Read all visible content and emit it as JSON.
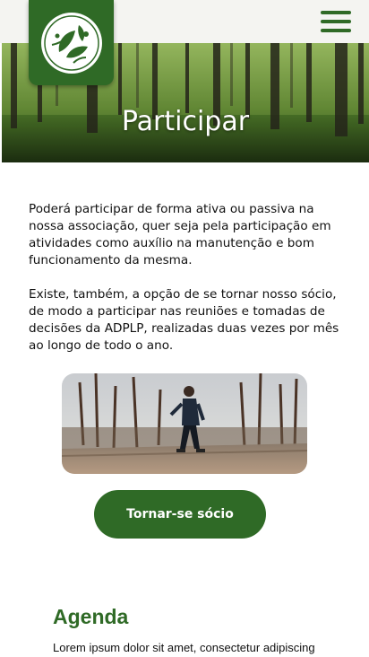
{
  "header": {
    "logo_icon": "leaf-circle-logo-icon",
    "menu_icon": "hamburger-menu-icon"
  },
  "hero": {
    "title": "Participar"
  },
  "main": {
    "paragraph_1": "Poderá participar de forma ativa ou passiva na nossa associação, quer seja pela participação em atividades como auxílio na manutenção e bom funcionamento da mesma.",
    "paragraph_2": "Existe, também, a opção de se tornar nosso sócio, de modo a participar nas reuniões e tomadas de decisões da ADPLP, realizadas duas vezes por mês ao longo de todo o ano.",
    "cta_label": "Tornar-se sócio"
  },
  "agenda": {
    "title": "Agenda",
    "text": "Lorem ipsum dolor sit amet, consectetur adipiscing"
  },
  "colors": {
    "brand_green": "#2f6a26",
    "topbar_bg": "#f4f4f1"
  }
}
